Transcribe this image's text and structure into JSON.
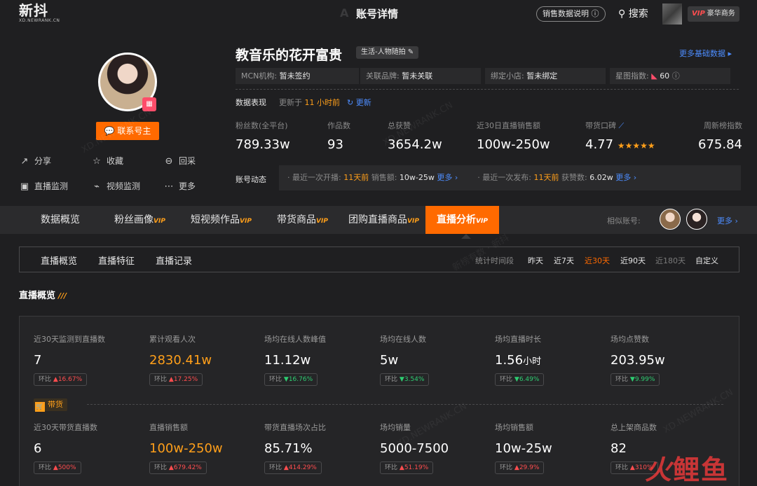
{
  "topbar": {
    "logo": "新抖",
    "logo_sub": "XD.NEWRANK.CN",
    "title": "账号详情",
    "ghost_text": "A T",
    "sales_explain": "销售数据说明 ⓘ",
    "search": "搜索",
    "vip_tag": "VIP",
    "vip_label": "豪华商务"
  },
  "profile": {
    "contact_button": "联系号主",
    "actions": [
      "分享",
      "收藏",
      "回采",
      "直播监测",
      "视频监测",
      "更多"
    ],
    "name": "教音乐的花开富贵",
    "category_tag": "生活-人物随拍",
    "more_basic": "更多基础数据 ▸",
    "info": [
      {
        "label": "MCN机构:",
        "value": "暂未签约"
      },
      {
        "label": "关联品牌:",
        "value": "暂未关联"
      },
      {
        "label": "绑定小店:",
        "value": "暂未绑定"
      },
      {
        "label": "星图指数:",
        "value": "60"
      }
    ],
    "perf_label": "数据表现",
    "perf_update_prefix": "更新于",
    "perf_update_time": "11 小时前",
    "refresh": "更新",
    "stats": [
      {
        "label": "粉丝数(全平台)",
        "value": "789.33w"
      },
      {
        "label": "作品数",
        "value": "93"
      },
      {
        "label": "总获赞",
        "value": "3654.2w"
      },
      {
        "label": "近30日直播销售额",
        "value": "100w-250w"
      },
      {
        "label": "带货口碑",
        "value": "4.77",
        "stars": "★★★★★"
      },
      {
        "label": "周新榜指数",
        "value": "675.84"
      }
    ],
    "dynamic_label": "账号动态",
    "dynamic": {
      "live_prefix": "· 最近一次开播:",
      "live_time": "11天前",
      "live_sales_label": "销售额:",
      "live_sales": "10w-25w",
      "more1": "更多 ›",
      "post_prefix": "· 最近一次发布:",
      "post_time": "11天前",
      "likes_label": "获赞数:",
      "likes": "6.02w",
      "more2": "更多 ›"
    }
  },
  "tabs": [
    {
      "label": "数据概览",
      "vip": ""
    },
    {
      "label": "粉丝画像",
      "vip": "VIP"
    },
    {
      "label": "短视频作品",
      "vip": "VIP"
    },
    {
      "label": "带货商品",
      "vip": "VIP"
    },
    {
      "label": "团购直播商品",
      "vip": "VIP"
    },
    {
      "label": "直播分析",
      "vip": "VIP"
    }
  ],
  "similar_label": "相似账号:",
  "more_similar": "更多 ›",
  "subtabs": [
    "直播概览",
    "直播特征",
    "直播记录"
  ],
  "range_label": "统计时间段",
  "ranges": [
    "昨天",
    "近7天",
    "近30天",
    "近90天",
    "近180天",
    "自定义"
  ],
  "section_title": "直播概览",
  "metrics_row1": [
    {
      "label": "近30天监测到直播数",
      "value": "7",
      "chg": "16.67%",
      "dir": "▲"
    },
    {
      "label": "累计观看人次",
      "value": "2830.41w",
      "chg": "17.25%",
      "dir": "▲"
    },
    {
      "label": "场均在线人数峰值",
      "value": "11.12w",
      "chg": "16.76%",
      "dir": "▼"
    },
    {
      "label": "场均在线人数",
      "value": "5w",
      "chg": "3.54%",
      "dir": "▼"
    },
    {
      "label": "场均直播时长",
      "value": "1.56",
      "unit": "小时",
      "chg": "6.49%",
      "dir": "▼"
    },
    {
      "label": "场均点赞数",
      "value": "203.95w",
      "chg": "9.99%",
      "dir": "▼"
    }
  ],
  "chg_prefix": "环比",
  "category_badge": "带货",
  "metrics_row2": [
    {
      "label": "近30天带货直播数",
      "value": "6",
      "chg": "500%",
      "dir": "▲"
    },
    {
      "label": "直播销售额",
      "value": "100w-250w",
      "chg": "679.42%",
      "dir": "▲"
    },
    {
      "label": "带货直播场次占比",
      "value": "85.71%",
      "chg": "414.29%",
      "dir": "▲"
    },
    {
      "label": "场均销量",
      "value": "5000-7500",
      "chg": "51.19%",
      "dir": "▲"
    },
    {
      "label": "场均销售额",
      "value": "10w-25w",
      "chg": "29.9%",
      "dir": "▲"
    },
    {
      "label": "总上架商品数",
      "value": "82",
      "chg": "310%",
      "dir": "▲"
    }
  ],
  "brand_corner": "鲤鱼",
  "colors": {
    "accent": "#ff6a00",
    "link": "#4d8dff",
    "up": "#ff4d4f",
    "down": "#2ecc71",
    "highlight": "#ff9f1a"
  }
}
